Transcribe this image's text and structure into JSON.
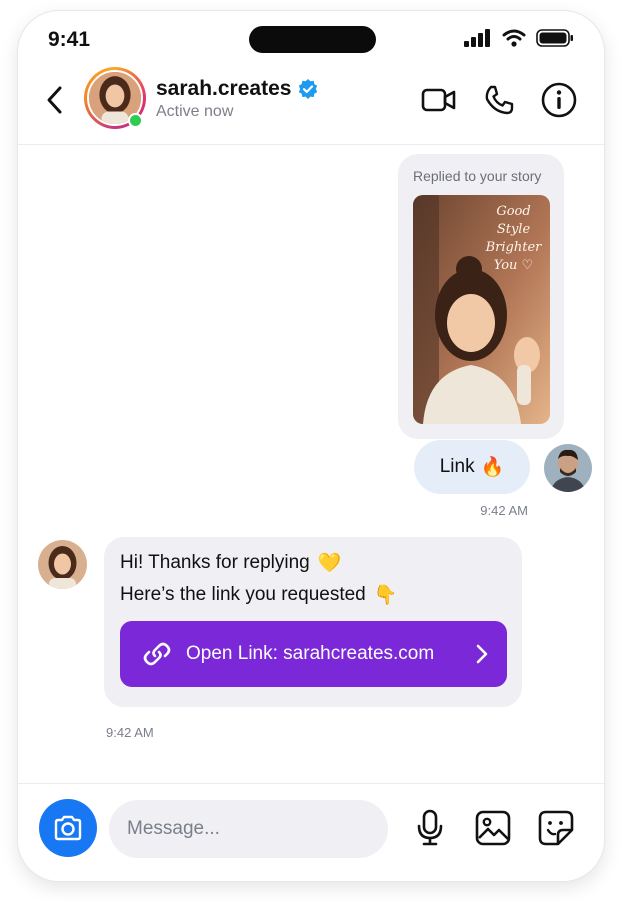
{
  "status_bar": {
    "time": "9:41"
  },
  "header": {
    "username": "sarah.creates",
    "status": "Active now",
    "icons": [
      "back-chevron-icon",
      "video-call-icon",
      "phone-call-icon",
      "info-icon",
      "verified-badge-icon"
    ]
  },
  "messages": {
    "story_reply": {
      "label": "Replied to your story",
      "story_caption": [
        "Good",
        "Style",
        "Brighter",
        "You ♡"
      ]
    },
    "outgoing": {
      "text": "Link",
      "emoji": "🔥",
      "time": "9:42 AM"
    },
    "incoming": {
      "line1": "Hi! Thanks for replying",
      "line1_emoji": "💛",
      "line2": "Here’s the link you requested",
      "line2_emoji": "👇",
      "link_button": "Open Link: sarahcreates.com",
      "time": "9:42 AM"
    }
  },
  "composer": {
    "placeholder": "Message...",
    "icons": [
      "camera-icon",
      "microphone-icon",
      "gallery-icon",
      "sticker-icon"
    ]
  },
  "colors": {
    "verified": "#1d9bf0",
    "link_button": "#7a28d8",
    "camera_button": "#1877f2",
    "online": "#2ecc52",
    "outgoing_bubble": "#e5eef8",
    "incoming_bubble": "#f0f0f4"
  }
}
